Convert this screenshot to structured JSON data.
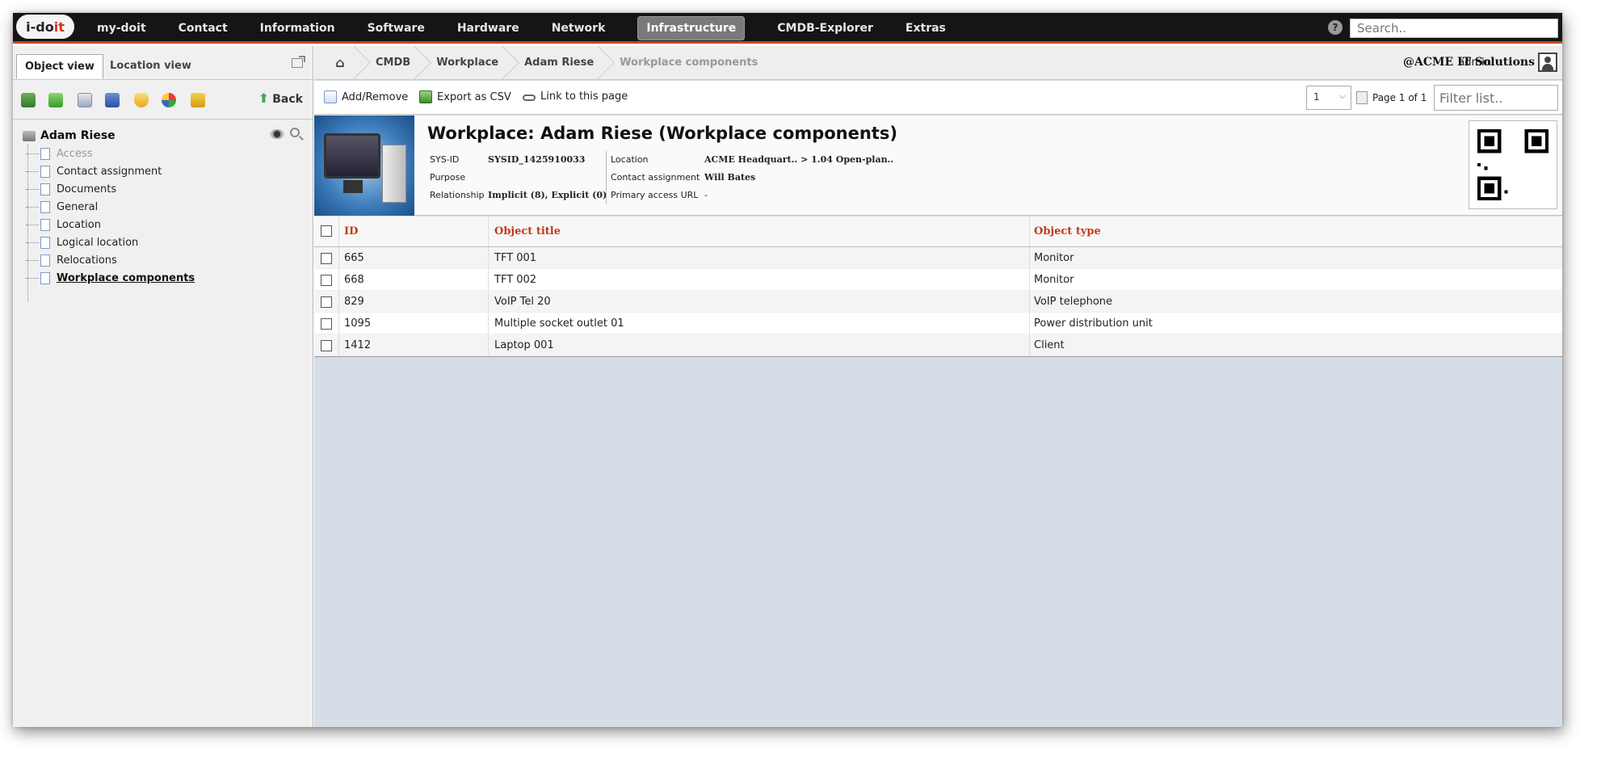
{
  "logo": {
    "text_i": "i-do",
    "text_it": "it"
  },
  "nav": {
    "items": [
      {
        "label": "my-doit",
        "active": false
      },
      {
        "label": "Contact",
        "active": false
      },
      {
        "label": "Information",
        "active": false
      },
      {
        "label": "Software",
        "active": false
      },
      {
        "label": "Hardware",
        "active": false
      },
      {
        "label": "Network",
        "active": false
      },
      {
        "label": "Infrastructure",
        "active": true
      },
      {
        "label": "CMDB-Explorer",
        "active": false
      },
      {
        "label": "Extras",
        "active": false
      }
    ],
    "help": "?",
    "search_placeholder": "Search.."
  },
  "left": {
    "tabs": {
      "object_view": "Object view",
      "location_view": "Location view"
    },
    "back_label": "Back",
    "tree": {
      "root": "Adam Riese",
      "items": [
        {
          "label": "Access",
          "state": "disabled"
        },
        {
          "label": "Contact assignment",
          "state": "normal"
        },
        {
          "label": "Documents",
          "state": "normal"
        },
        {
          "label": "General",
          "state": "normal"
        },
        {
          "label": "Location",
          "state": "normal"
        },
        {
          "label": "Logical location",
          "state": "normal"
        },
        {
          "label": "Relocations",
          "state": "normal"
        },
        {
          "label": "Workplace components",
          "state": "selected"
        }
      ]
    }
  },
  "breadcrumb": {
    "home_icon": "home-icon",
    "items": [
      "CMDB",
      "Workplace",
      "Adam Riese",
      "Workplace components"
    ]
  },
  "user": {
    "name": "admin",
    "tenant": "@ACME IT Solutions"
  },
  "actions": {
    "add_remove": "Add/Remove",
    "export_csv": "Export as CSV",
    "link": "Link to this page",
    "page_value": "1",
    "page_info": "Page 1 of 1",
    "filter_placeholder": "Filter list.."
  },
  "object": {
    "title": "Workplace: Adam Riese (Workplace components)",
    "fields": {
      "sysid_label": "SYS-ID",
      "sysid_value": "SYSID_1425910033",
      "purpose_label": "Purpose",
      "purpose_value": "",
      "relationship_label": "Relationship",
      "relationship_value": "Implicit (8), Explicit (0)",
      "location_label": "Location",
      "location_value": "ACME Headquart.. > 1.04 Open-plan..",
      "contact_label": "Contact assignment",
      "contact_value": "Will Bates",
      "url_label": "Primary access URL",
      "url_value": "-"
    }
  },
  "table": {
    "headers": {
      "id": "ID",
      "title": "Object title",
      "type": "Object type"
    },
    "rows": [
      {
        "id": "665",
        "title": "TFT 001",
        "type": "Monitor"
      },
      {
        "id": "668",
        "title": "TFT 002",
        "type": "Monitor"
      },
      {
        "id": "829",
        "title": "VoIP Tel 20",
        "type": "VoIP telephone"
      },
      {
        "id": "1095",
        "title": "Multiple socket outlet 01",
        "type": "Power distribution unit"
      },
      {
        "id": "1412",
        "title": "Laptop 001",
        "type": "Client"
      }
    ]
  },
  "colors": {
    "accent": "#c2491f",
    "header_link": "#c23a1a",
    "navbar": "#151515",
    "content_bg": "#d5dde6"
  }
}
